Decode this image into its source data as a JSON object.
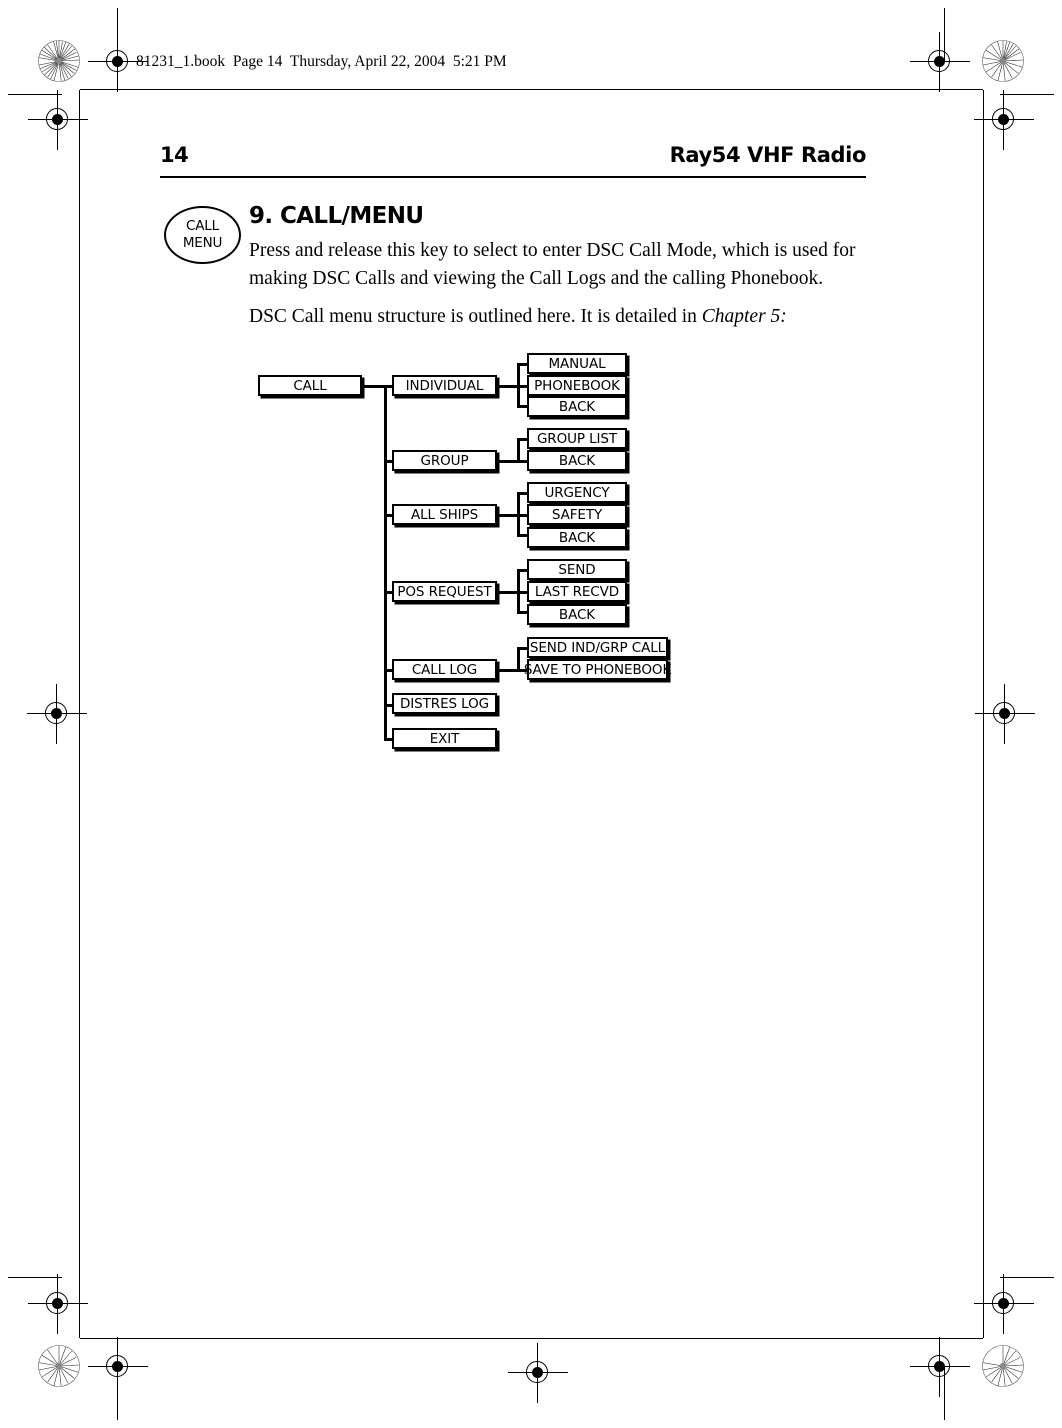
{
  "page": {
    "book_line": "81231_1.book  Page 14  Thursday, April 22, 2004  5:21 PM",
    "page_number": "14",
    "running_head": "Ray54 VHF Radio"
  },
  "key_icon": {
    "line1": "CALL",
    "line2": "MENU"
  },
  "section": {
    "heading": "9. CALL/MENU",
    "paragraph1": "Press and release this key to select to enter DSC Call Mode, which is used for making DSC Calls and viewing the Call Logs and the calling Phonebook.",
    "paragraph2_before": "DSC Call menu structure is outlined here. It is detailed in ",
    "paragraph2_italic": "Chapter 5:"
  },
  "diagram": {
    "root": "CALL",
    "level1": [
      "INDIVIDUAL",
      "GROUP",
      "ALL SHIPS",
      "POS REQUEST",
      "CALL LOG",
      "DISTRES LOG",
      "EXIT"
    ],
    "level2": {
      "individual": [
        "MANUAL",
        "PHONEBOOK",
        "BACK"
      ],
      "group": [
        "GROUP LIST",
        "BACK"
      ],
      "all_ships": [
        "URGENCY",
        "SAFETY",
        "BACK"
      ],
      "pos_request": [
        "SEND",
        "LAST RECVD",
        "BACK"
      ],
      "call_log": [
        "SEND IND/GRP CALL",
        "SAVE TO PHONEBOOK"
      ]
    }
  }
}
